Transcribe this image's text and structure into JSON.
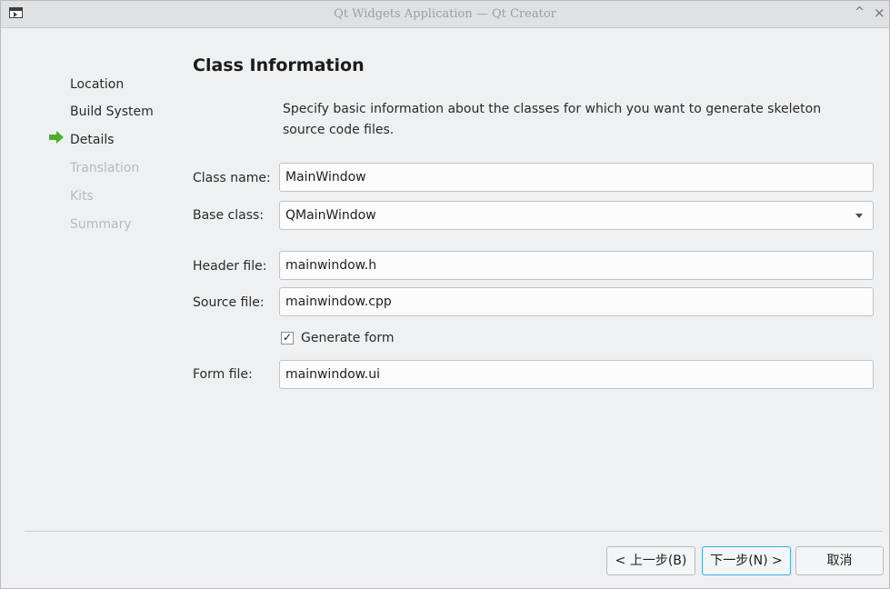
{
  "window": {
    "title": "Qt Widgets Application — Qt Creator"
  },
  "titlebar": {
    "collapse_glyph": "^",
    "close_glyph": "×"
  },
  "nav": {
    "items": [
      {
        "label": "Location",
        "state": "done"
      },
      {
        "label": "Build System",
        "state": "done"
      },
      {
        "label": "Details",
        "state": "current"
      },
      {
        "label": "Translation",
        "state": "disabled"
      },
      {
        "label": "Kits",
        "state": "disabled"
      },
      {
        "label": "Summary",
        "state": "disabled"
      }
    ]
  },
  "page": {
    "title": "Class Information",
    "description": "Specify basic information about the classes for which you want to generate skeleton source code files."
  },
  "form": {
    "class_name": {
      "label": "Class name:",
      "value": "MainWindow"
    },
    "base_class": {
      "label": "Base class:",
      "value": "QMainWindow"
    },
    "header_file": {
      "label": "Header file:",
      "value": "mainwindow.h"
    },
    "source_file": {
      "label": "Source file:",
      "value": "mainwindow.cpp"
    },
    "generate_form": {
      "label": "Generate form",
      "checked": true,
      "check_glyph": "✓"
    },
    "form_file": {
      "label": "Form file:",
      "value": "mainwindow.ui"
    }
  },
  "buttons": {
    "back": "< 上一步(B)",
    "next": "下一步(N) >",
    "cancel": "取消"
  },
  "colors": {
    "accent": "#3daee9",
    "current_step_arrow": "#4caf2b",
    "disabled_text": "#b7babd",
    "window_bg": "#eff0f1"
  }
}
